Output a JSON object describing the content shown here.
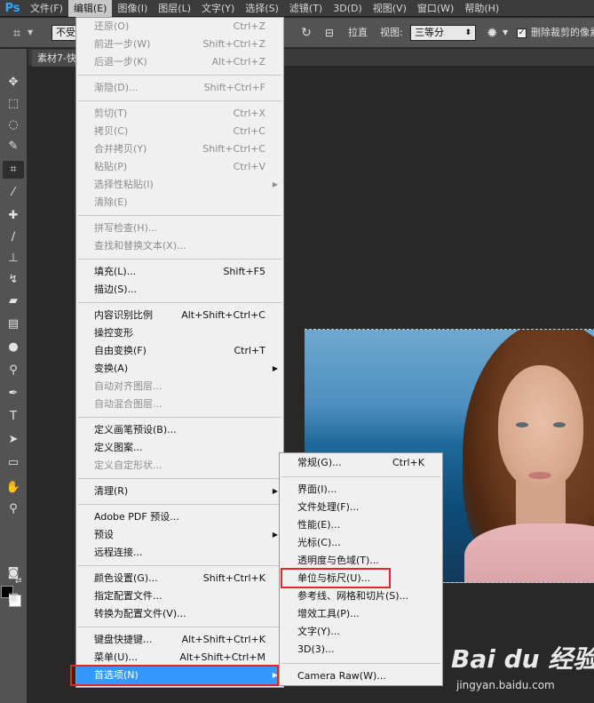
{
  "app": {
    "logo": "Ps"
  },
  "menubar": [
    "文件(F)",
    "编辑(E)",
    "图像(I)",
    "图层(L)",
    "文字(Y)",
    "选择(S)",
    "滤镜(T)",
    "3D(D)",
    "视图(V)",
    "窗口(W)",
    "帮助(H)"
  ],
  "options": {
    "ratio_value": "不受",
    "straighten": "拉直",
    "view_label": "视图:",
    "view_value": "三等分",
    "delete_cropped": "删除裁剪的像素",
    "delete_checked": true
  },
  "document": {
    "tab": "素材7-快"
  },
  "edit_menu": [
    {
      "label": "还原(O)",
      "shortcut": "Ctrl+Z",
      "disabled": true
    },
    {
      "label": "前进一步(W)",
      "shortcut": "Shift+Ctrl+Z",
      "disabled": true
    },
    {
      "label": "后退一步(K)",
      "shortcut": "Alt+Ctrl+Z",
      "disabled": true
    },
    {
      "sep": true
    },
    {
      "label": "渐隐(D)...",
      "shortcut": "Shift+Ctrl+F",
      "disabled": true
    },
    {
      "sep": true
    },
    {
      "label": "剪切(T)",
      "shortcut": "Ctrl+X",
      "disabled": true
    },
    {
      "label": "拷贝(C)",
      "shortcut": "Ctrl+C",
      "disabled": true
    },
    {
      "label": "合并拷贝(Y)",
      "shortcut": "Shift+Ctrl+C",
      "disabled": true
    },
    {
      "label": "粘贴(P)",
      "shortcut": "Ctrl+V",
      "disabled": true
    },
    {
      "label": "选择性粘贴(I)",
      "shortcut": "",
      "disabled": true,
      "submenu": true
    },
    {
      "label": "清除(E)",
      "shortcut": "",
      "disabled": true
    },
    {
      "sep": true
    },
    {
      "label": "拼写检查(H)...",
      "shortcut": "",
      "disabled": true
    },
    {
      "label": "查找和替换文本(X)...",
      "shortcut": "",
      "disabled": true
    },
    {
      "sep": true
    },
    {
      "label": "填充(L)...",
      "shortcut": "Shift+F5",
      "disabled": false
    },
    {
      "label": "描边(S)...",
      "shortcut": "",
      "disabled": false
    },
    {
      "sep": true
    },
    {
      "label": "内容识别比例",
      "shortcut": "Alt+Shift+Ctrl+C",
      "disabled": false
    },
    {
      "label": "操控变形",
      "shortcut": "",
      "disabled": false
    },
    {
      "label": "自由变换(F)",
      "shortcut": "Ctrl+T",
      "disabled": false
    },
    {
      "label": "变换(A)",
      "shortcut": "",
      "disabled": false,
      "submenu": true
    },
    {
      "label": "自动对齐图层...",
      "shortcut": "",
      "disabled": true
    },
    {
      "label": "自动混合图层...",
      "shortcut": "",
      "disabled": true
    },
    {
      "sep": true
    },
    {
      "label": "定义画笔预设(B)...",
      "shortcut": "",
      "disabled": false
    },
    {
      "label": "定义图案...",
      "shortcut": "",
      "disabled": false
    },
    {
      "label": "定义自定形状...",
      "shortcut": "",
      "disabled": true
    },
    {
      "sep": true
    },
    {
      "label": "清理(R)",
      "shortcut": "",
      "disabled": false,
      "submenu": true
    },
    {
      "sep": true
    },
    {
      "label": "Adobe PDF 预设...",
      "shortcut": "",
      "disabled": false
    },
    {
      "label": "预设",
      "shortcut": "",
      "disabled": false,
      "submenu": true
    },
    {
      "label": "远程连接...",
      "shortcut": "",
      "disabled": false
    },
    {
      "sep": true
    },
    {
      "label": "颜色设置(G)...",
      "shortcut": "Shift+Ctrl+K",
      "disabled": false
    },
    {
      "label": "指定配置文件...",
      "shortcut": "",
      "disabled": false
    },
    {
      "label": "转换为配置文件(V)...",
      "shortcut": "",
      "disabled": false
    },
    {
      "sep": true
    },
    {
      "label": "键盘快捷键...",
      "shortcut": "Alt+Shift+Ctrl+K",
      "disabled": false
    },
    {
      "label": "菜单(U)...",
      "shortcut": "Alt+Shift+Ctrl+M",
      "disabled": false
    },
    {
      "label": "首选项(N)",
      "shortcut": "",
      "disabled": false,
      "submenu": true,
      "highlighted": true
    }
  ],
  "prefs_menu": [
    {
      "label": "常规(G)...",
      "shortcut": "Ctrl+K"
    },
    {
      "sep": true
    },
    {
      "label": "界面(I)...",
      "shortcut": ""
    },
    {
      "label": "文件处理(F)...",
      "shortcut": ""
    },
    {
      "label": "性能(E)...",
      "shortcut": ""
    },
    {
      "label": "光标(C)...",
      "shortcut": ""
    },
    {
      "label": "透明度与色域(T)...",
      "shortcut": ""
    },
    {
      "label": "单位与标尺(U)...",
      "shortcut": "",
      "boxed": true
    },
    {
      "label": "参考线、网格和切片(S)...",
      "shortcut": ""
    },
    {
      "label": "增效工具(P)...",
      "shortcut": ""
    },
    {
      "label": "文字(Y)...",
      "shortcut": ""
    },
    {
      "label": "3D(3)...",
      "shortcut": ""
    },
    {
      "sep": true
    },
    {
      "label": "Camera Raw(W)...",
      "shortcut": ""
    }
  ],
  "watermark": {
    "main": "Bai du 经验",
    "sub": "jingyan.baidu.com"
  }
}
